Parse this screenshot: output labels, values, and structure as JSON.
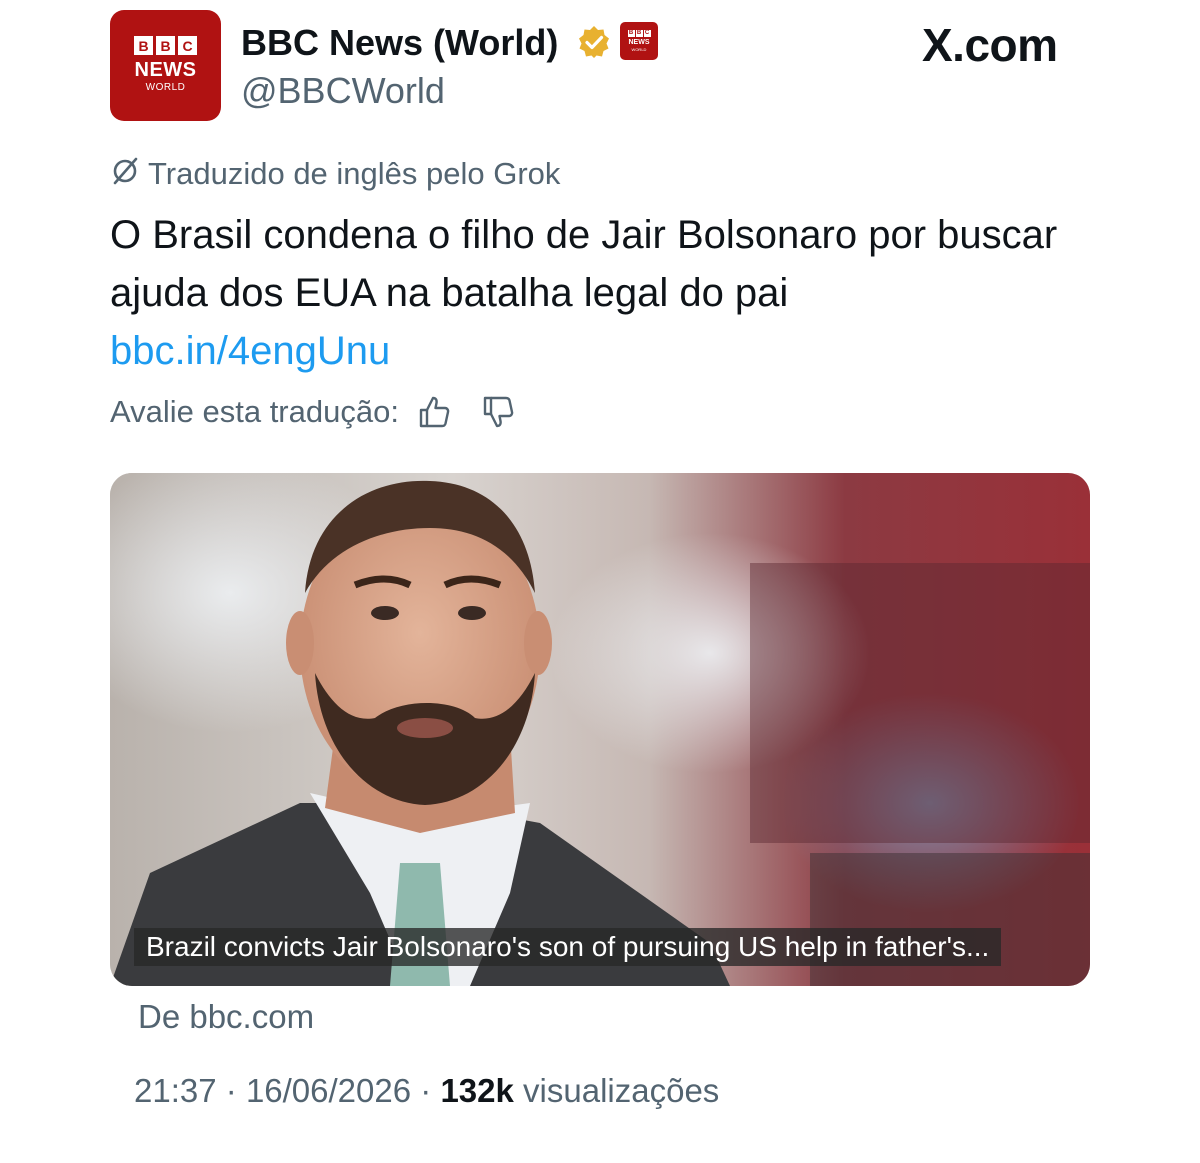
{
  "account": {
    "logo": {
      "blocks": [
        "B",
        "B",
        "C"
      ],
      "line1": "NEWS",
      "line2": "WORLD"
    },
    "display_name": "BBC News (World)",
    "handle": "@BBCWorld",
    "verified_badge_color": "#e8b130",
    "brand_color": "#b01212"
  },
  "site_label": "X.com",
  "translation": {
    "note": "Traduzido de inglês pelo Grok",
    "icon": "translate-slash-icon"
  },
  "post": {
    "text": "O Brasil condena o filho de Jair Bolsonaro por buscar ajuda dos EUA na batalha legal do pai",
    "link": "bbc.in/4engUnu",
    "link_color": "#1d9bf0"
  },
  "rating": {
    "label": "Avalie esta tradução:",
    "thumbs_up_icon": "thumbs-up-icon",
    "thumbs_down_icon": "thumbs-down-icon"
  },
  "card": {
    "caption": "Brazil convicts Jair Bolsonaro's son of pursuing US help in father's...",
    "source": "De bbc.com"
  },
  "meta": {
    "time": "21:37",
    "separator": "·",
    "date": "16/06/2026",
    "views_count": "132k",
    "views_label": "visualizações"
  }
}
